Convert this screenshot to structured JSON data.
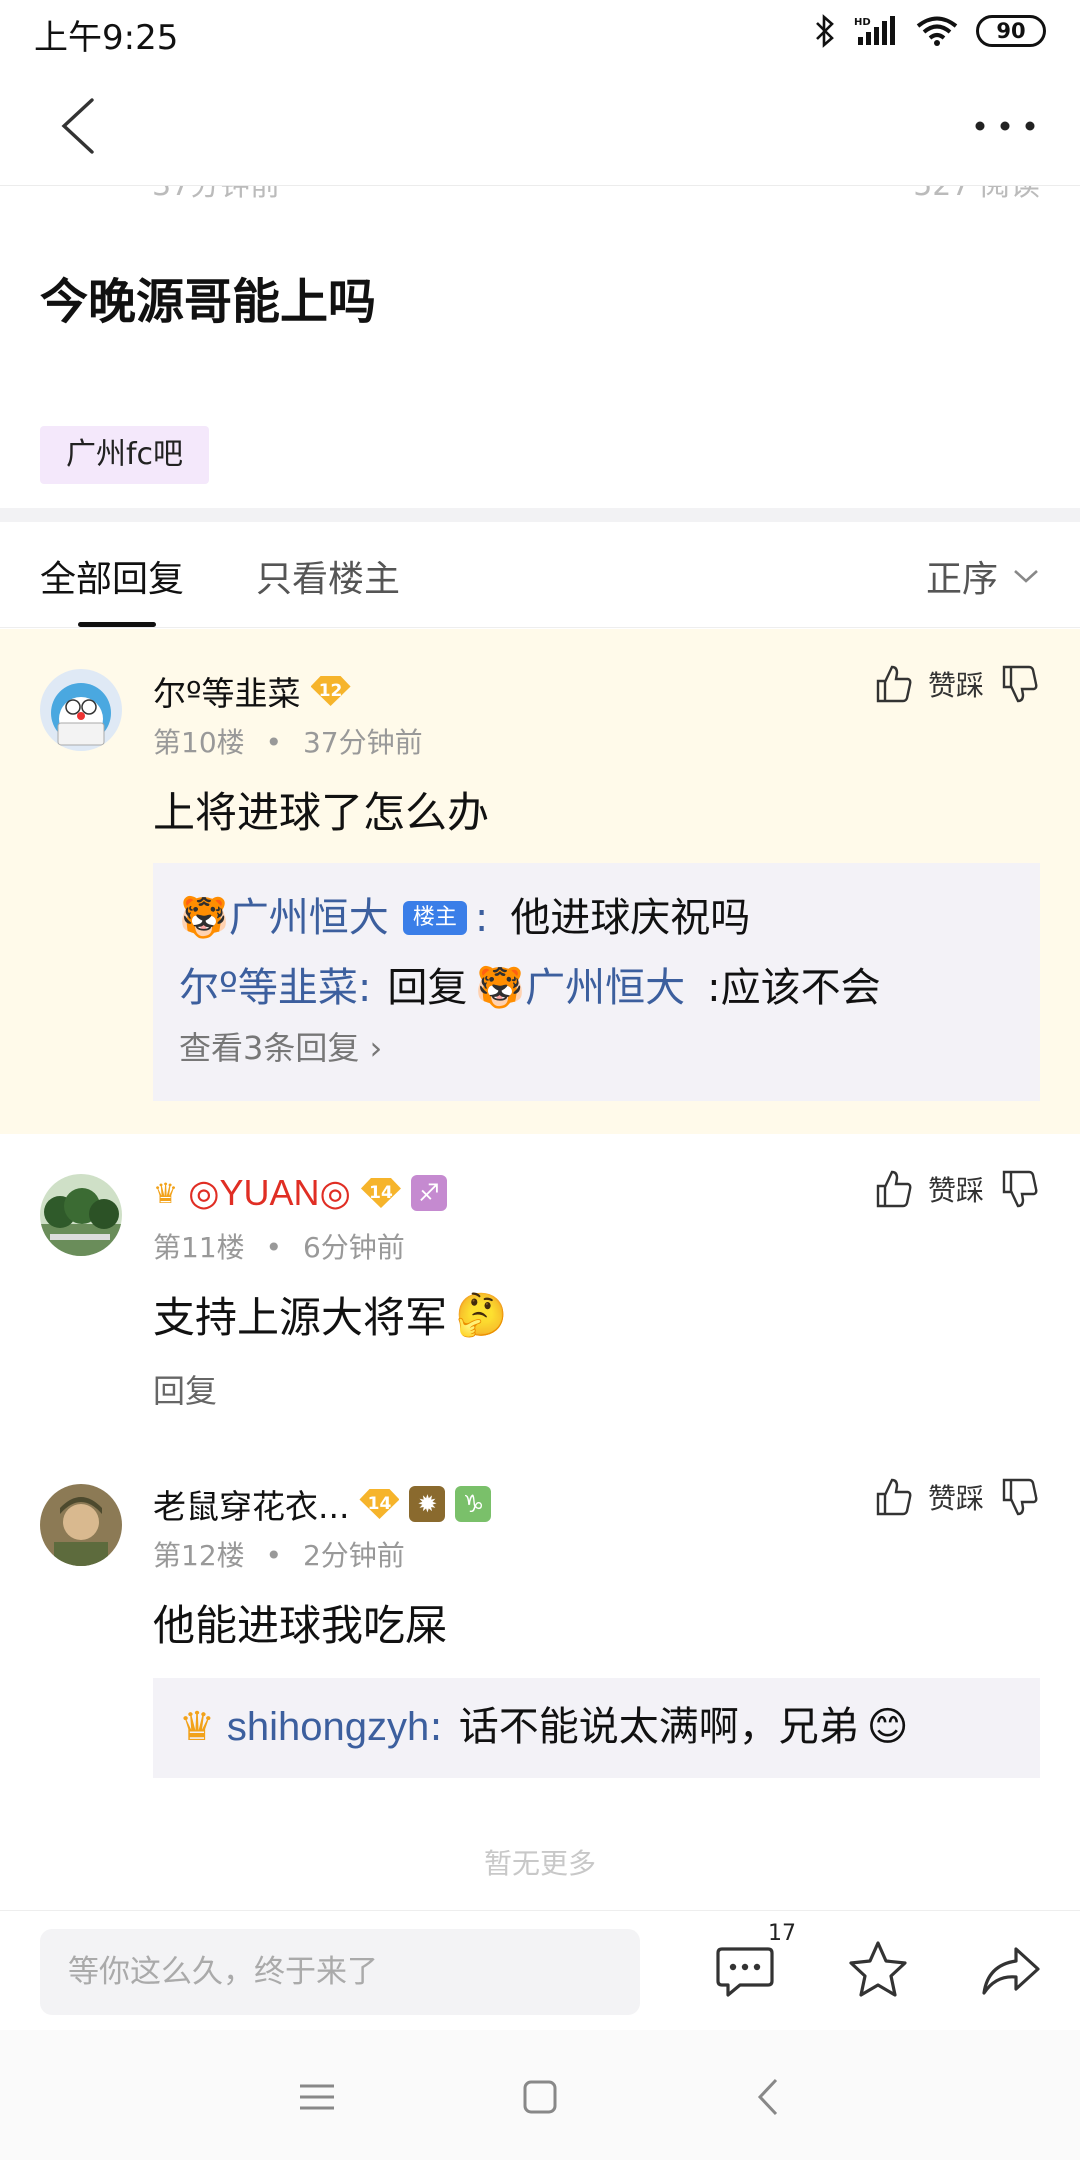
{
  "status_bar": {
    "time": "上午9:25",
    "battery": "90"
  },
  "nav": {
    "back": "back",
    "more": "more"
  },
  "post": {
    "ghost_time": "37分钟前",
    "ghost_read": "527 阅读",
    "title": "今晚源哥能上吗",
    "forum_tag": "广州fc吧"
  },
  "tabs": {
    "all": "全部回复",
    "lz_only": "只看楼主",
    "sort": "正序"
  },
  "replies": [
    {
      "username": "尔º等韭菜",
      "level": "12",
      "floor": "第10楼",
      "time": "37分钟前",
      "content": "上将进球了怎么办",
      "action_label": "赞踩",
      "sub": {
        "line1_user": "广州恒大",
        "line1_badge": "楼主",
        "line1_sep": ":",
        "line1_text": "他进球庆祝吗",
        "line2_user": "尔º等韭菜",
        "line2_sep": ":",
        "line2_reply": "回复",
        "line2_target": "广州恒大",
        "line2_text": ":应该不会",
        "more": "查看3条回复"
      }
    },
    {
      "username": "◎YUAN◎",
      "level": "14",
      "floor": "第11楼",
      "time": "6分钟前",
      "content": "支持上源大将军",
      "action_label": "赞踩",
      "reply_link": "回复"
    },
    {
      "username": "老鼠穿花衣...",
      "level": "14",
      "floor": "第12楼",
      "time": "2分钟前",
      "content": "他能进球我吃屎",
      "action_label": "赞踩",
      "sub": {
        "line1_user": "shihongzyh",
        "line1_sep": ":",
        "line1_text": "话不能说太满啊，兄弟"
      }
    }
  ],
  "meta_dot": "•",
  "footer": {
    "no_more": "暂无更多"
  },
  "bottom_bar": {
    "placeholder": "等你这么久，终于来了",
    "comment_count": "17"
  },
  "colors": {
    "highlight_bg": "#fffaea",
    "link_blue": "#3c5f9e",
    "louzhu_blue": "#3a7ee8",
    "name_red": "#e02e24"
  }
}
